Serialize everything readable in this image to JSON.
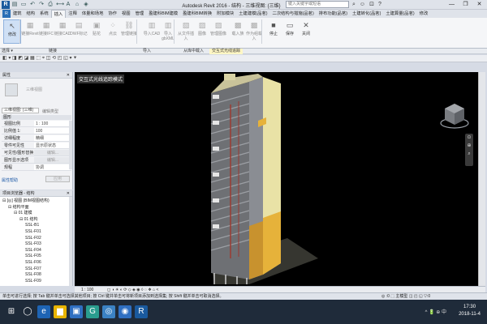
{
  "title_bar": {
    "app_icon": "R",
    "title": "Autodesk Revit 2016 -    结构 - 三维视图: {三维}",
    "search_placeholder": "键入关键字或短语",
    "right_icons": [
      "search-icon",
      "user-icon",
      "cart-icon",
      "help-icon"
    ],
    "window_controls": [
      "—",
      "❐",
      "✕"
    ]
  },
  "ribbon_tabs": [
    {
      "label": "R",
      "style": "file"
    },
    {
      "label": "建筑"
    },
    {
      "label": "结构"
    },
    {
      "label": "系统"
    },
    {
      "label": "插入",
      "style": "active"
    },
    {
      "label": "注释"
    },
    {
      "label": "体量和场地"
    },
    {
      "label": "协作"
    },
    {
      "label": "视图"
    },
    {
      "label": "管理"
    },
    {
      "label": "盈建科BIM建模"
    },
    {
      "label": "盈建科BIM转换"
    },
    {
      "label": "附加模块"
    },
    {
      "label": "土建建模(品茗)"
    },
    {
      "label": "二次结构与措施(品茗)"
    },
    {
      "label": "排布功能(品茗)"
    },
    {
      "label": "土建转化(品茗)"
    },
    {
      "label": "土建算量(品茗)"
    },
    {
      "label": "修改"
    }
  ],
  "ribbon_buttons": [
    {
      "label": "修改",
      "icon": "↖",
      "name": "modify"
    },
    {
      "label": "链接Revit",
      "icon": "▦",
      "name": "link-revit"
    },
    {
      "label": "链接IFC",
      "icon": "▦",
      "name": "link-ifc"
    },
    {
      "label": "链接CAD",
      "icon": "▦",
      "name": "link-cad"
    },
    {
      "label": "DWF标记",
      "icon": "▤",
      "name": "dwf-markup"
    },
    {
      "label": "贴花",
      "icon": "▣",
      "name": "decal"
    },
    {
      "label": "点云",
      "icon": "⁘",
      "name": "point-cloud"
    },
    {
      "label": "管理链接",
      "icon": "⛓",
      "name": "manage-links"
    },
    {
      "label": "导入CAD",
      "icon": "▥",
      "name": "import-cad"
    },
    {
      "label": "导入gbXML",
      "icon": "▥",
      "name": "import-gbxml"
    },
    {
      "label": "从文件插入",
      "icon": "▧",
      "name": "insert-from-file"
    },
    {
      "label": "图像",
      "icon": "▨",
      "name": "image"
    },
    {
      "label": "管理图像",
      "icon": "▨",
      "name": "manage-images"
    },
    {
      "label": "载入族",
      "icon": "▩",
      "name": "load-family"
    },
    {
      "label": "作为组载入",
      "icon": "▩",
      "name": "load-as-group"
    },
    {
      "label": "停止",
      "icon": "■",
      "name": "stop"
    },
    {
      "label": "保存",
      "icon": "▭",
      "name": "save"
    },
    {
      "label": "关闭",
      "icon": "✕",
      "name": "close"
    }
  ],
  "panel_labels": [
    "选择 ▾",
    "链接",
    "导入",
    "从库中载入",
    "交互式光线追踪"
  ],
  "options_bar": {
    "icons": "◧ ▾ ◨ ◩ ◪ ▦ ⬚ ⌖ ◫ ⟲ ◰ ◱ ▾ ⯆"
  },
  "properties": {
    "header": "属性",
    "type_name": "三维视图",
    "view_selector": "三维视图: {三维}",
    "edit_type": "编辑类型",
    "group": "图形",
    "rows": [
      {
        "k": "视图比例",
        "v": "1 : 100"
      },
      {
        "k": "比例值 1:",
        "v": "100"
      },
      {
        "k": "详细程度",
        "v": "精细"
      },
      {
        "k": "零件可见性",
        "v": "显示原状态"
      },
      {
        "k": "可见性/图形替换",
        "v": "编辑...",
        "btn": true
      },
      {
        "k": "图形显示选项",
        "v": "编辑...",
        "btn": true
      },
      {
        "k": "规程",
        "v": "协调"
      }
    ],
    "help": "属性帮助",
    "apply": "应用"
  },
  "browser": {
    "header": "项目浏览器 - 结构",
    "nodes": [
      {
        "t": "⊟ [◎] 视图 (BIM视图结构)",
        "lvl": 0
      },
      {
        "t": "⊟ 结构平面",
        "lvl": 1
      },
      {
        "t": "⊟ 01 建模",
        "lvl": 2
      },
      {
        "t": "⊟ 01 结构",
        "lvl": 3
      },
      {
        "t": "SSL-B1",
        "lvl": 4
      },
      {
        "t": "SSL-F01",
        "lvl": 4
      },
      {
        "t": "SSL-F02",
        "lvl": 4
      },
      {
        "t": "SSL-F03",
        "lvl": 4
      },
      {
        "t": "SSL-F04",
        "lvl": 4
      },
      {
        "t": "SSL-F05",
        "lvl": 4
      },
      {
        "t": "SSL-F06",
        "lvl": 4
      },
      {
        "t": "SSL-F07",
        "lvl": 4
      },
      {
        "t": "SSL-F08",
        "lvl": 4
      },
      {
        "t": "SSL-F09",
        "lvl": 4
      }
    ]
  },
  "viewport": {
    "title": "交互式光线追踪模式",
    "viewcube_label": "",
    "nav_icons": [
      "⊙",
      "⊕",
      "⌕"
    ]
  },
  "view_control": {
    "scale": "1 : 100",
    "icons": "◻ ◑ ☀ ◐ ⟳ ◇ ◈ ◉ ◊ ◌ ❖ ⌂ <"
  },
  "status_bar": {
    "text": "单击可进行选择; 按 Tab 键并单击可选择其他项目; 按 Ctrl 键并单击可将新项目添加到选择集; 按 Shift 键并单击可取消选择。",
    "right_icons": "◎ :0  ⬚ 主模型  ◫ ◰ ◱ ▽:0"
  },
  "taskbar": {
    "icons": [
      {
        "g": "⊞",
        "c": "#ffffff",
        "bg": "transparent",
        "name": "windows-start-icon"
      },
      {
        "g": "◯",
        "c": "#ffffff",
        "bg": "transparent",
        "name": "search-icon"
      },
      {
        "g": "e",
        "c": "#ffffff",
        "bg": "#1e64b4",
        "name": "edge-icon"
      },
      {
        "g": "▆",
        "c": "#ffffff",
        "bg": "#e8b400",
        "name": "file-explorer-icon"
      },
      {
        "g": "▣",
        "c": "#ffffff",
        "bg": "#2f6fc1",
        "name": "store-icon"
      },
      {
        "g": "G",
        "c": "#ffffff",
        "bg": "#2a9d8f",
        "name": "app-g-icon"
      },
      {
        "g": "◎",
        "c": "#ffffff",
        "bg": "#3b82c4",
        "name": "qq-browser-icon"
      },
      {
        "g": "◉",
        "c": "#ffffff",
        "bg": "#2f6fc1",
        "name": "network-icon"
      },
      {
        "g": "R",
        "c": "#ffffff",
        "bg": "#1a5a9e",
        "name": "revit-icon"
      }
    ],
    "tray": "^  🔋  ⊕  中",
    "time": "17:30",
    "date": "2018-11-4"
  },
  "colors": {
    "building_yellow": "#e9e2a6",
    "building_orange": "#e6b23a",
    "active_tab": "#2b6fb6"
  }
}
